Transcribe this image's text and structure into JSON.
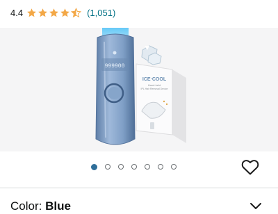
{
  "rating": {
    "value": "4.4",
    "stars": 4.4,
    "review_count": "(1,051)"
  },
  "product_image": {
    "device_display": "999900",
    "box_title": "ICE·COOL",
    "box_subtitle": "Hand-held",
    "box_line": "IPL Hair Removal Device"
  },
  "carousel": {
    "total": 7,
    "active_index": 0
  },
  "variation": {
    "label": "Color:",
    "value": "Blue"
  },
  "colors": {
    "star": "#f3a847",
    "link": "#007185",
    "dot_active": "#2e6e99",
    "device": "#7f9fc6"
  }
}
